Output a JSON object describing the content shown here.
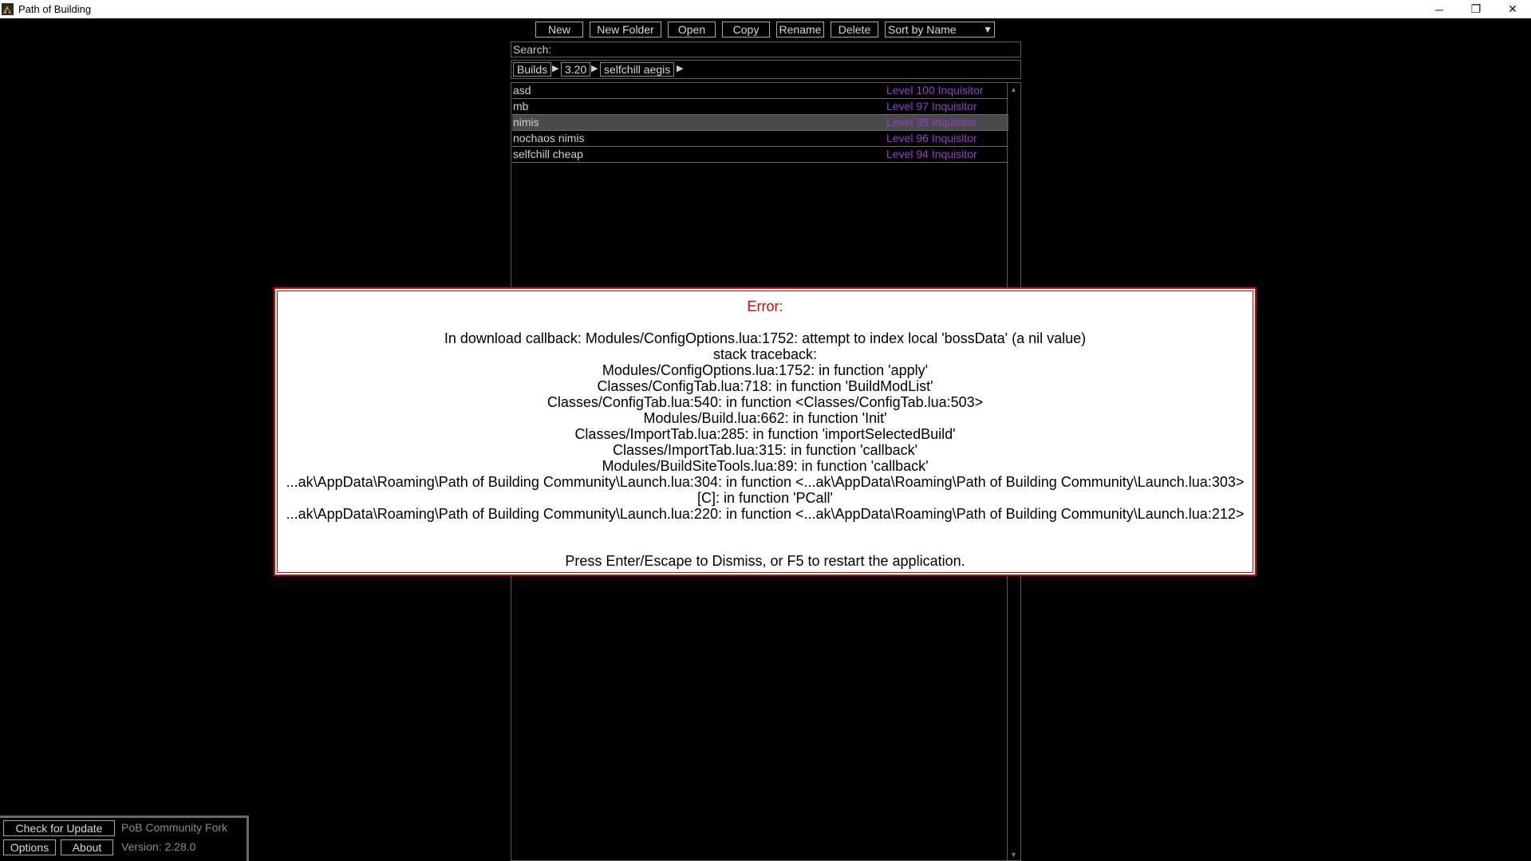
{
  "window": {
    "title": "Path of Building",
    "controls": {
      "minimize": "─",
      "restore": "❐",
      "close": "✕"
    }
  },
  "toolbar": {
    "new_label": "New",
    "new_folder_label": "New Folder",
    "open_label": "Open",
    "copy_label": "Copy",
    "rename_label": "Rename",
    "delete_label": "Delete",
    "sort_label": "Sort by Name"
  },
  "search": {
    "label": "Search:"
  },
  "breadcrumb": {
    "items": [
      "Builds",
      "3.20",
      "selfchill aegis"
    ]
  },
  "builds": [
    {
      "name": "asd",
      "level": "Level 100 Inquisitor"
    },
    {
      "name": "mb",
      "level": "Level 97 Inquisitor"
    },
    {
      "name": "nimis",
      "level": "Level 95 Inquisitor",
      "selected": true
    },
    {
      "name": "nochaos nimis",
      "level": "Level 96 Inquisitor"
    },
    {
      "name": "selfchill cheap",
      "level": "Level 94 Inquisitor"
    }
  ],
  "error": {
    "title": "Error:",
    "lines": [
      "In download callback: Modules/ConfigOptions.lua:1752: attempt to index local 'bossData' (a nil value)",
      "stack traceback:",
      "Modules/ConfigOptions.lua:1752: in function 'apply'",
      "Classes/ConfigTab.lua:718: in function 'BuildModList'",
      "Classes/ConfigTab.lua:540: in function <Classes/ConfigTab.lua:503>",
      "Modules/Build.lua:662: in function 'Init'",
      "Classes/ImportTab.lua:285: in function 'importSelectedBuild'",
      "Classes/ImportTab.lua:315: in function 'callback'",
      "Modules/BuildSiteTools.lua:89: in function 'callback'",
      "...ak\\AppData\\Roaming\\Path of Building Community\\Launch.lua:304: in function <...ak\\AppData\\Roaming\\Path of Building Community\\Launch.lua:303>",
      "[C]: in function 'PCall'",
      "...ak\\AppData\\Roaming\\Path of Building Community\\Launch.lua:220: in function <...ak\\AppData\\Roaming\\Path of Building Community\\Launch.lua:212>"
    ],
    "footer": "Press Enter/Escape to Dismiss, or F5 to restart the application."
  },
  "bottom": {
    "check_update_label": "Check for Update",
    "fork_label": "PoB Community Fork",
    "options_label": "Options",
    "about_label": "About",
    "version_label": "Version: 2.28.0"
  },
  "colors": {
    "level_text": "#9440c8",
    "error_border": "#d60000",
    "error_title": "#e00000"
  }
}
